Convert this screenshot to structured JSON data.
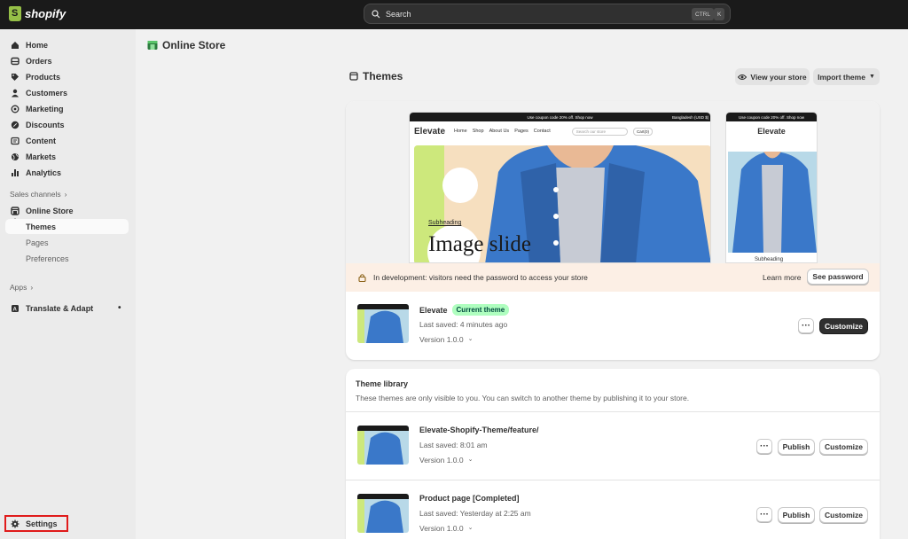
{
  "app": {
    "brand": "shopify"
  },
  "search": {
    "placeholder": "Search",
    "shortcut_1": "CTRL",
    "shortcut_2": "K"
  },
  "sidebar": {
    "items": [
      {
        "label": "Home",
        "icon": "home-icon"
      },
      {
        "label": "Orders",
        "icon": "orders-icon"
      },
      {
        "label": "Products",
        "icon": "tag-icon"
      },
      {
        "label": "Customers",
        "icon": "person-icon"
      },
      {
        "label": "Marketing",
        "icon": "target-icon"
      },
      {
        "label": "Discounts",
        "icon": "discount-icon"
      },
      {
        "label": "Content",
        "icon": "content-icon"
      },
      {
        "label": "Markets",
        "icon": "globe-icon"
      },
      {
        "label": "Analytics",
        "icon": "bar-chart-icon"
      }
    ],
    "sales_channels_label": "Sales channels",
    "online_store": "Online Store",
    "sub_items": [
      "Themes",
      "Pages",
      "Preferences"
    ],
    "apps_label": "Apps",
    "translate": "Translate & Adapt",
    "settings": "Settings"
  },
  "page": {
    "title": "Online Store"
  },
  "themes": {
    "title": "Themes",
    "view_store": "View your store",
    "import_theme": "Import theme",
    "preview": {
      "desktop_announcement": "Use coupon code 20% off. Shop now",
      "mobile_announcement": "Use coupon code 20% off. Shop now",
      "currency": "Bangladesh (USD $)",
      "logo": "Elevate",
      "nav": [
        "Home",
        "Shop",
        "About Us",
        "Pages",
        "Contact"
      ],
      "search_placeholder": "Search our store",
      "cart": "Cart(0)",
      "subheading": "Subheading",
      "hero_text": "Image slide",
      "mobile_subheading": "Subheading"
    },
    "banner": {
      "text": "In development: visitors need the password to access your store",
      "learn_more": "Learn more",
      "see_password": "See password"
    },
    "current": {
      "name": "Elevate",
      "badge": "Current theme",
      "saved": "Last saved: 4 minutes ago",
      "version": "Version 1.0.0",
      "customize": "Customize"
    }
  },
  "library": {
    "title": "Theme library",
    "subtitle": "These themes are only visible to you. You can switch to another theme by publishing it to your store.",
    "rows": [
      {
        "name": "Elevate-Shopify-Theme/feature/",
        "saved": "Last saved: 8:01 am",
        "version": "Version 1.0.0",
        "publish": "Publish",
        "customize": "Customize"
      },
      {
        "name": "Product page [Completed]",
        "saved": "Last saved: Yesterday at 2:25 am",
        "version": "Version 1.0.0",
        "publish": "Publish",
        "customize": "Customize"
      }
    ]
  }
}
